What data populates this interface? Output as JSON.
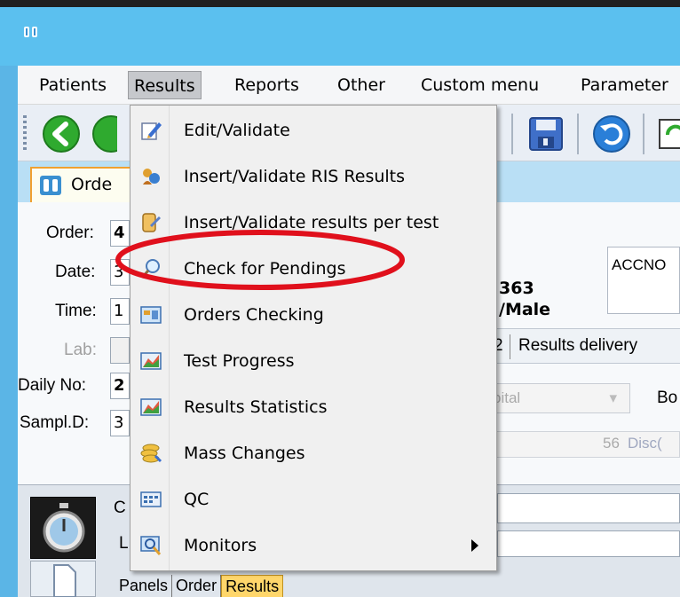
{
  "window": {
    "frame_color": "#5bc0ef"
  },
  "menubar": {
    "items": [
      {
        "label": "Patients"
      },
      {
        "label": "Results"
      },
      {
        "label": "Reports"
      },
      {
        "label": "Other"
      },
      {
        "label": "Custom menu"
      },
      {
        "label": "Parameter"
      }
    ],
    "active": "Results"
  },
  "toolbar": {
    "buttons": [
      "back-icon",
      "forward-icon",
      "save-icon",
      "undo-icon",
      "refresh-icon"
    ]
  },
  "doc_tab": {
    "label": "Orde"
  },
  "form": {
    "order_label": "Order:",
    "order_value": "4",
    "date_label": "Date:",
    "date_value": "3",
    "time_label": "Time:",
    "time_value": "1",
    "lab_label": "Lab:",
    "daily_no_label": "Daily No:",
    "daily_no_value": "2",
    "sampl_d_label": "Sampl.D:",
    "sampl_d_value": "3",
    "patient_id_fragment": "363",
    "patient_sex_fragment": "/Male",
    "accno_label": "ACCNO"
  },
  "right_tabs": {
    "num": "2",
    "label": "Results delivery"
  },
  "hospital_dropdown": {
    "value": "oital"
  },
  "bo_label": "Bo",
  "disc_row": {
    "num": "56",
    "label": "Disc("
  },
  "lower": {
    "letter_c": "C",
    "letter_l": "L"
  },
  "bottom_tabs": {
    "panels": "Panels",
    "order": "Order",
    "results": "Results"
  },
  "results_menu": {
    "items": [
      {
        "label": "Edit/Validate",
        "icon": "edit-pencil-icon"
      },
      {
        "label": "Insert/Validate RIS Results",
        "icon": "ris-icon"
      },
      {
        "label": "Insert/Validate results per test",
        "icon": "test-tube-icon"
      },
      {
        "label": "Check for Pendings",
        "icon": "magnifier-icon"
      },
      {
        "label": "Orders Checking",
        "icon": "orders-checking-icon"
      },
      {
        "label": "Test Progress",
        "icon": "chart-icon"
      },
      {
        "label": "Results Statistics",
        "icon": "chart-icon"
      },
      {
        "label": "Mass Changes",
        "icon": "mass-changes-icon"
      },
      {
        "label": "QC",
        "icon": "qc-icon"
      },
      {
        "label": "Monitors",
        "icon": "monitor-icon",
        "has_submenu": true
      }
    ],
    "highlighted": "Check for Pendings",
    "highlight_color": "#e0101c"
  }
}
